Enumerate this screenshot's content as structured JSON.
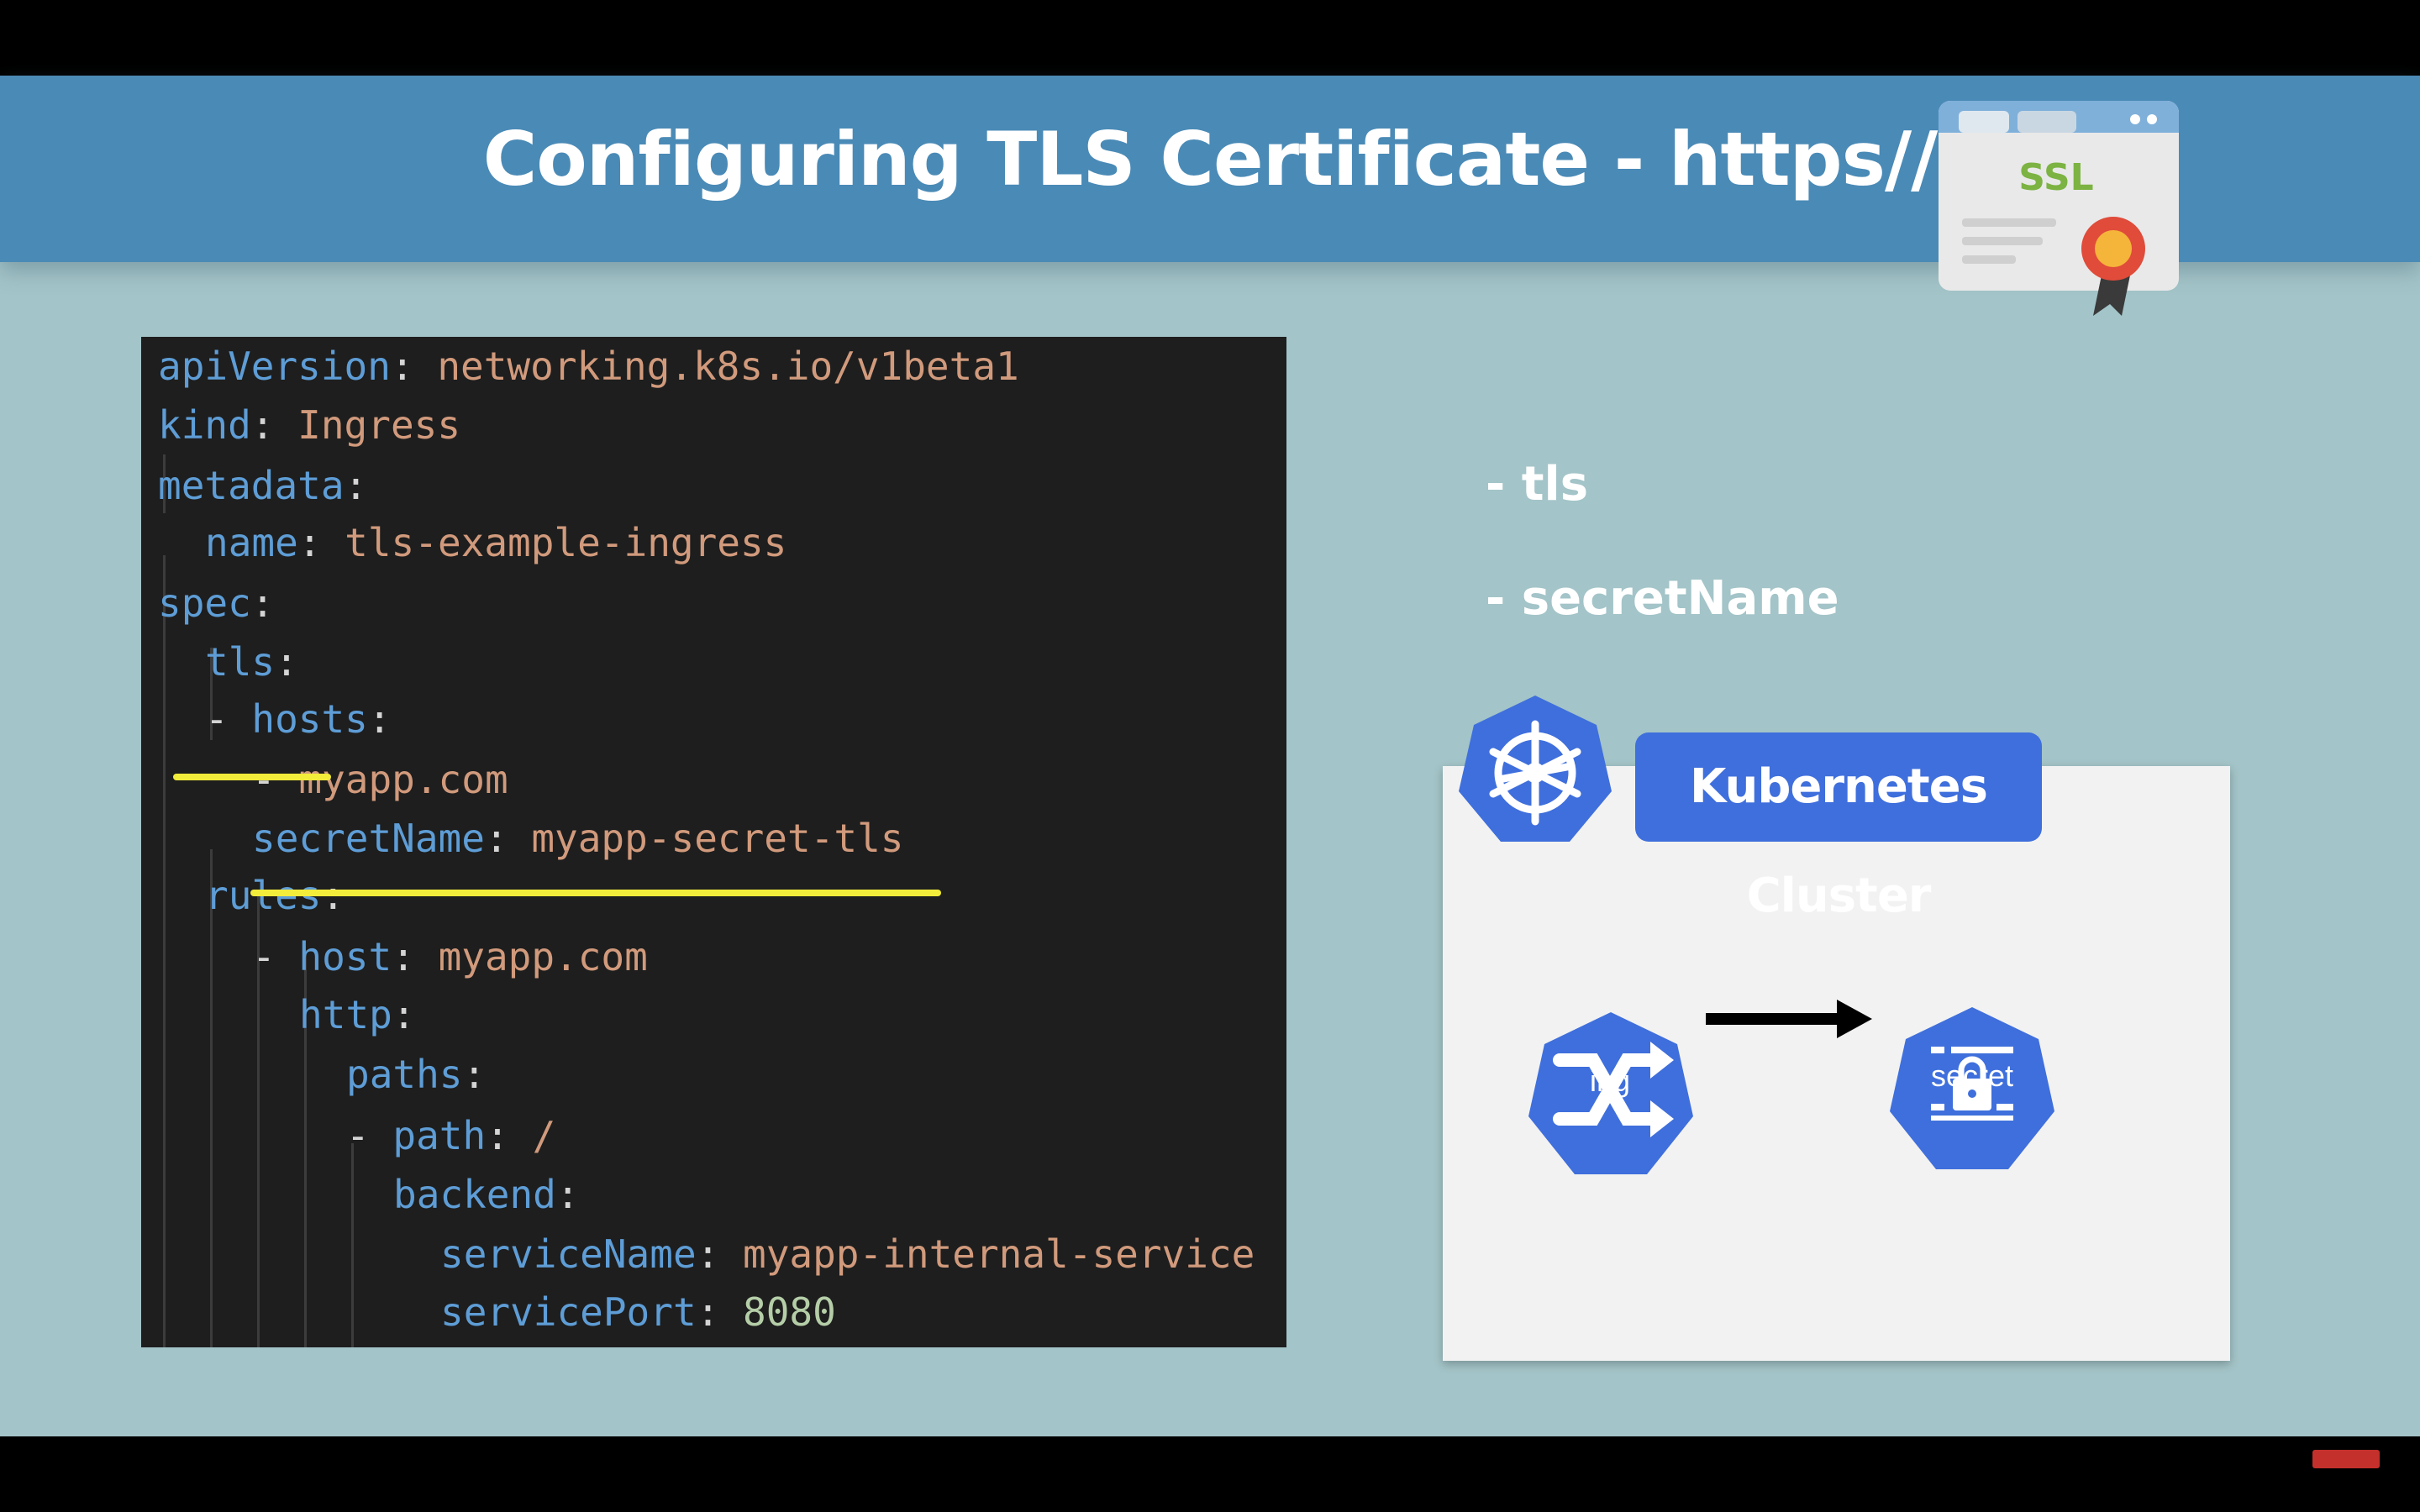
{
  "slide": {
    "title": "Configuring TLS Certificate - https//",
    "ssl_badge_text": "SSL"
  },
  "yaml": {
    "line1": {
      "key": "apiVersion",
      "sep": ": ",
      "value": "networking.k8s.io/v1beta1"
    },
    "line2": {
      "key": "kind",
      "sep": ": ",
      "value": "Ingress"
    },
    "line3": {
      "key": "metadata",
      "sep": ":"
    },
    "line4": {
      "key": "name",
      "sep": ": ",
      "value": "tls-example-ingress"
    },
    "line5": {
      "key": "spec",
      "sep": ":"
    },
    "line6": {
      "key": "tls",
      "sep": ":"
    },
    "line7": {
      "dash": "- ",
      "key": "hosts",
      "sep": ":"
    },
    "line8": {
      "dash": "- ",
      "value": "myapp.com"
    },
    "line9": {
      "key": "secretName",
      "sep": ": ",
      "value": "myapp-secret-tls"
    },
    "line10": {
      "key": "rules",
      "sep": ":"
    },
    "line11": {
      "dash": "- ",
      "key": "host",
      "sep": ": ",
      "value": "myapp.com"
    },
    "line12": {
      "key": "http",
      "sep": ":"
    },
    "line13": {
      "key": "paths",
      "sep": ":"
    },
    "line14": {
      "dash": "- ",
      "key": "path",
      "sep": ": ",
      "value": "/"
    },
    "line15": {
      "key": "backend",
      "sep": ":"
    },
    "line16": {
      "key": "serviceName",
      "sep": ": ",
      "value": "myapp-internal-service"
    },
    "line17": {
      "key": "servicePort",
      "sep": ": ",
      "value": "8080"
    }
  },
  "bullets": {
    "tls": "- tls",
    "secretName": "- secretName"
  },
  "diagram": {
    "cluster_label": "Kubernetes Cluster",
    "ingress_label": "ing",
    "secret_label": "secret"
  },
  "colors": {
    "header": "#4a8ab6",
    "background": "#a3c4c8",
    "k8s_blue": "#3f6fdc",
    "highlight": "#f2ec3a"
  },
  "icons": {
    "kubernetes": "kubernetes-helm-icon",
    "ingress": "ingress-icon",
    "secret": "secret-lock-icon",
    "arrow": "arrow-right-icon",
    "ssl": "ssl-certificate-icon"
  }
}
